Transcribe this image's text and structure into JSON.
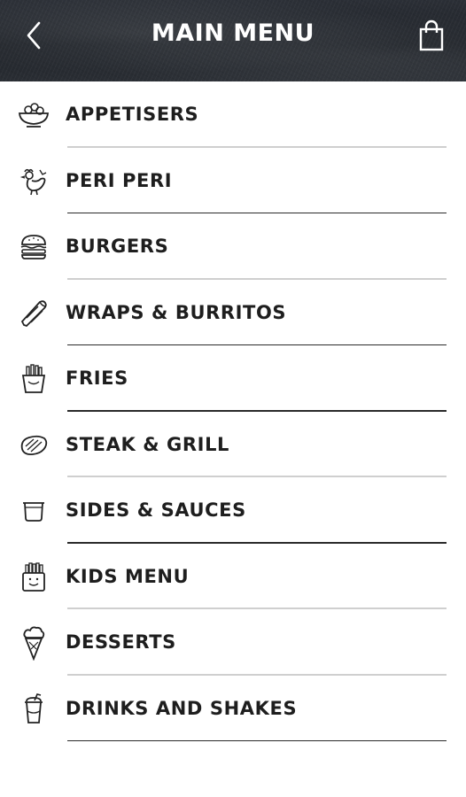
{
  "header": {
    "title": "MAIN MENU"
  },
  "menu": {
    "items": [
      {
        "label": "APPETISERS",
        "icon": "bowl-icon"
      },
      {
        "label": "PERI PERI",
        "icon": "chicken-icon"
      },
      {
        "label": "BURGERS",
        "icon": "burger-icon"
      },
      {
        "label": "WRAPS & BURRITOS",
        "icon": "wrap-icon"
      },
      {
        "label": "FRIES",
        "icon": "fries-icon"
      },
      {
        "label": "STEAK & GRILL",
        "icon": "steak-icon"
      },
      {
        "label": "SIDES & SAUCES",
        "icon": "sauce-cup-icon"
      },
      {
        "label": "KIDS MENU",
        "icon": "kids-fries-icon"
      },
      {
        "label": "DESSERTS",
        "icon": "ice-cream-icon"
      },
      {
        "label": "DRINKS AND SHAKES",
        "icon": "drink-cup-icon"
      }
    ]
  }
}
